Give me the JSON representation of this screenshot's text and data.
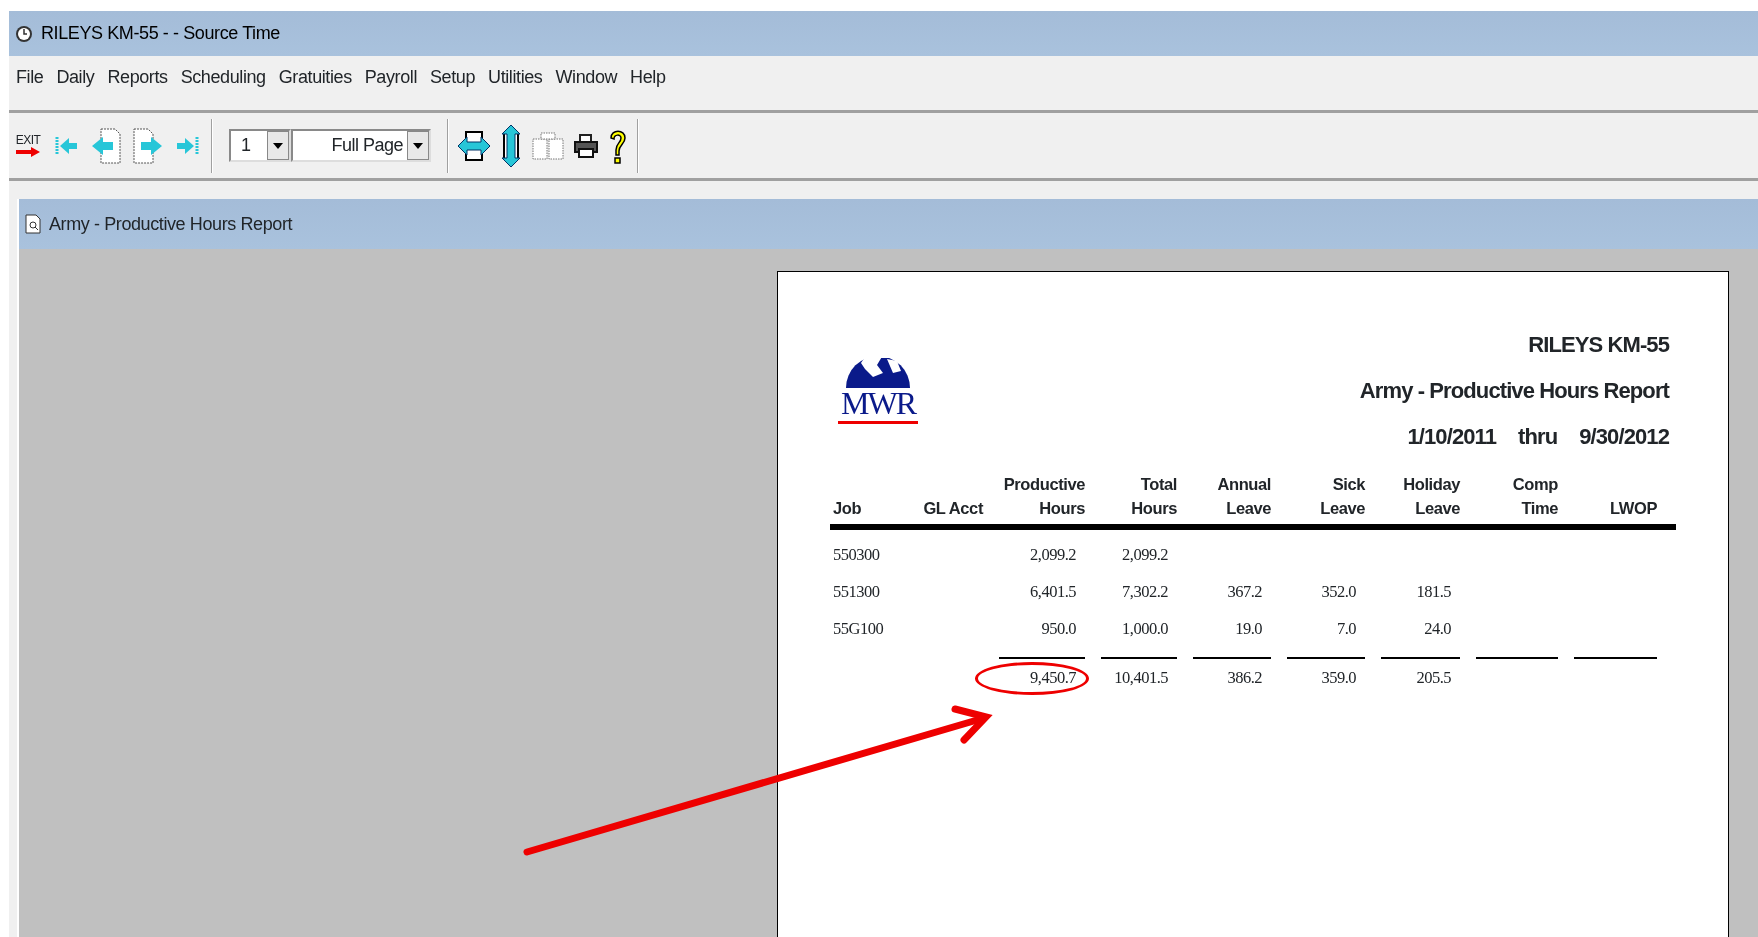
{
  "window": {
    "title": "RILEYS KM-55 -  - Source Time"
  },
  "menu": [
    "File",
    "Daily",
    "Reports",
    "Scheduling",
    "Gratuities",
    "Payroll",
    "Setup",
    "Utilities",
    "Window",
    "Help"
  ],
  "toolbar": {
    "exit_label": "EXIT",
    "page": "1",
    "zoom": "Full Page"
  },
  "child_window": {
    "title": "Army - Productive Hours Report"
  },
  "report": {
    "logo_text": "MWR",
    "company": "RILEYS KM-55",
    "title": "Army - Productive Hours Report",
    "date_from": "1/10/2011",
    "thru": "thru",
    "date_to": "9/30/2012",
    "columns": [
      [
        "Job"
      ],
      [
        "GL Acct"
      ],
      [
        "Productive",
        "Hours"
      ],
      [
        "Total",
        "Hours"
      ],
      [
        "Annual",
        "Leave"
      ],
      [
        "Sick",
        "Leave"
      ],
      [
        "Holiday",
        "Leave"
      ],
      [
        "Comp",
        "Time"
      ],
      [
        "LWOP"
      ]
    ],
    "rows": [
      {
        "job": "550300",
        "values": [
          "2,099.2",
          "2,099.2"
        ]
      },
      {
        "job": "551300",
        "values": [
          "6,401.5",
          "7,302.2",
          "367.2",
          "352.0",
          "181.5"
        ]
      },
      {
        "job": "55G100",
        "values": [
          "950.0",
          "1,000.0",
          "19.0",
          "7.0",
          "24.0"
        ]
      }
    ],
    "totals": [
      {
        "value": "9,450.7",
        "circled": true
      },
      {
        "value": "10,401.5",
        "circled": false
      },
      {
        "value": "386.2",
        "circled": false
      },
      {
        "value": "359.0",
        "circled": false
      },
      {
        "value": "205.5",
        "circled": false
      }
    ]
  }
}
